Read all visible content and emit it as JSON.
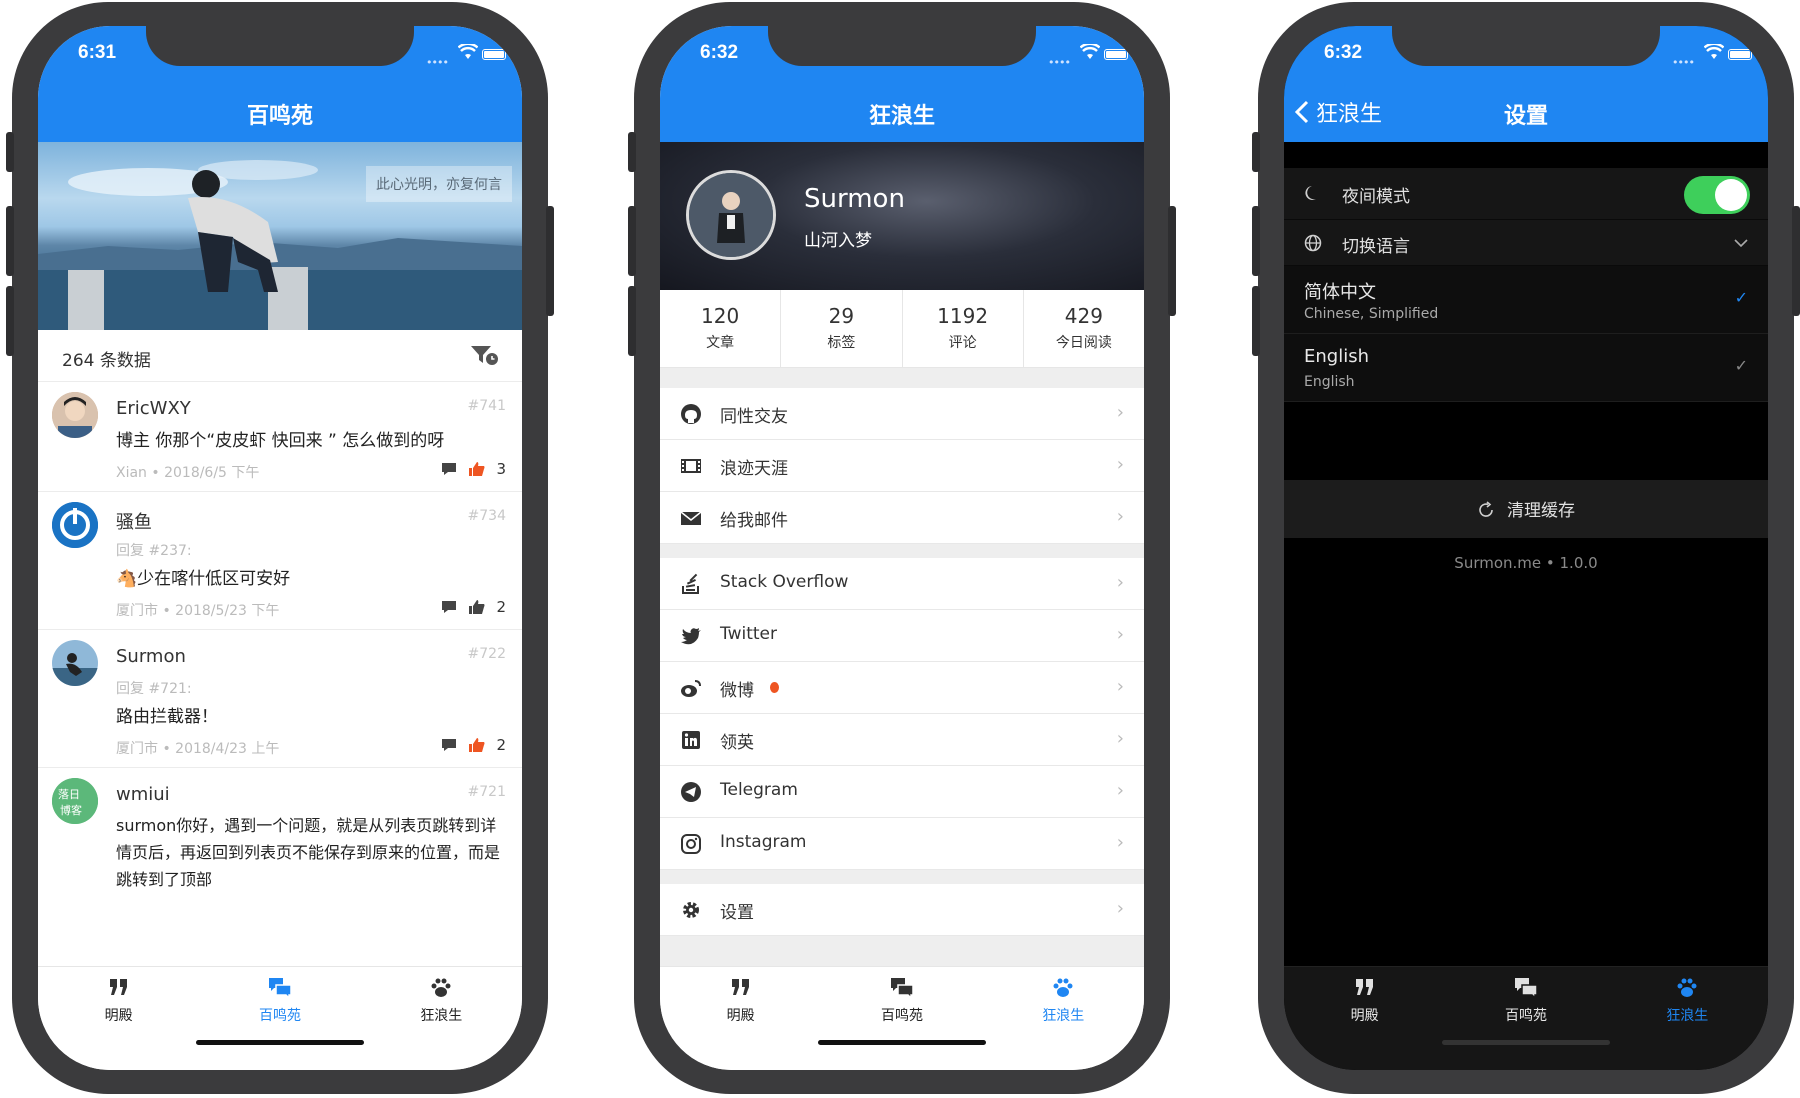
{
  "colors": {
    "brand": "#1f86f2",
    "accent_orange": "#ee5522",
    "toggle_on": "#3ecf5b"
  },
  "tabs": [
    {
      "label": "明殿",
      "icon": "quote-icon"
    },
    {
      "label": "百鸣苑",
      "icon": "chat-icon"
    },
    {
      "label": "狂浪生",
      "icon": "paw-icon"
    }
  ],
  "screen1": {
    "time": "6:31",
    "title": "百鸣苑",
    "banner_quote": "此心光明，亦复何言",
    "count_label": "264 条数据",
    "comments": [
      {
        "name": "EricWXY",
        "num": "#741",
        "reply": "",
        "text": "博主 你那个“皮皮虾 快回来 ” 怎么做到的呀",
        "meta": "Xian • 2018/6/5 下午",
        "likes": "3"
      },
      {
        "name": "骚鱼",
        "num": "#734",
        "reply": "回复 #237:",
        "text": "🐴少在喀什低区可安好",
        "meta": "厦门市 • 2018/5/23 下午",
        "likes": "2"
      },
      {
        "name": "Surmon",
        "num": "#722",
        "reply": "回复 #721:",
        "text": "路由拦截器！",
        "meta": "厦门市 • 2018/4/23 上午",
        "likes": "2"
      },
      {
        "name": "wmiui",
        "num": "#721",
        "reply": "",
        "text": "surmon你好，遇到一个问题，就是从列表页跳转到详情页后，再返回到列表页不能保存到原来的位置，而是跳转到了顶部",
        "meta": "",
        "likes": ""
      }
    ],
    "avatar_text_wmiui": "落日博客"
  },
  "screen2": {
    "time": "6:32",
    "title": "狂浪生",
    "profile_name": "Surmon",
    "profile_slogan": "山河入梦",
    "stats": [
      {
        "value": "120",
        "label": "文章"
      },
      {
        "value": "29",
        "label": "标签"
      },
      {
        "value": "1192",
        "label": "评论"
      },
      {
        "value": "429",
        "label": "今日阅读"
      }
    ],
    "menu": [
      {
        "label": "同性交友",
        "icon": "github-icon"
      },
      {
        "label": "浪迹天涯",
        "icon": "film-icon"
      },
      {
        "label": "给我邮件",
        "icon": "mail-icon"
      },
      {
        "label": "Stack Overflow",
        "icon": "stackoverflow-icon"
      },
      {
        "label": "Twitter",
        "icon": "twitter-icon"
      },
      {
        "label": "微博",
        "icon": "weibo-icon"
      },
      {
        "label": "领英",
        "icon": "linkedin-icon"
      },
      {
        "label": "Telegram",
        "icon": "telegram-icon"
      },
      {
        "label": "Instagram",
        "icon": "instagram-icon"
      },
      {
        "label": "设置",
        "icon": "gear-icon"
      }
    ]
  },
  "screen3": {
    "time": "6:32",
    "back_label": "狂浪生",
    "title": "设置",
    "night_mode_label": "夜间模式",
    "night_mode_on": true,
    "language_label": "切换语言",
    "languages": [
      {
        "name": "简体中文",
        "sub": "Chinese, Simplified",
        "selected": true
      },
      {
        "name": "English",
        "sub": "English",
        "selected": false
      }
    ],
    "clear_cache_label": "清理缓存",
    "version": "Surmon.me • 1.0.0"
  }
}
